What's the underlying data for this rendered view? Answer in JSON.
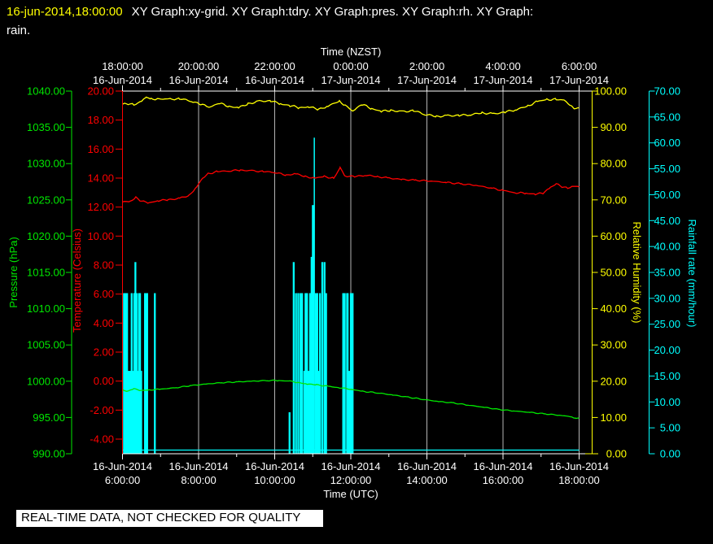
{
  "header": {
    "timestamp": "16-jun-2014,18:00:00",
    "title_rest": "XY Graph:xy-grid.  XY Graph:tdry.  XY Graph:pres.  XY Graph:rh.  XY Graph:",
    "title_line2": "rain."
  },
  "footer": {
    "notice": "REAL-TIME DATA, NOT CHECKED FOR QUALITY"
  },
  "colors": {
    "background": "#000000",
    "pressure": "#00e800",
    "temperature": "#ff0000",
    "humidity": "#ffff00",
    "rain": "#00ffff",
    "grid": "#b5b5b5",
    "axis": "#ffffff"
  },
  "chart_data": {
    "type": "line+bar, multi-axis time series",
    "axes": {
      "top": {
        "title": "Time (NZST)",
        "hours_utc": [
          6,
          8,
          10,
          12,
          14,
          16,
          18
        ],
        "tick_times": [
          "18:00:00",
          "20:00:00",
          "22:00:00",
          "0:00:00",
          "2:00:00",
          "4:00:00",
          "6:00:00"
        ],
        "tick_dates": [
          "16-Jun-2014",
          "16-Jun-2014",
          "16-Jun-2014",
          "17-Jun-2014",
          "17-Jun-2014",
          "17-Jun-2014",
          "17-Jun-2014"
        ]
      },
      "bottom": {
        "title": "Time (UTC)",
        "hours_utc": [
          6,
          8,
          10,
          12,
          14,
          16,
          18
        ],
        "tick_dates": [
          "16-Jun-2014",
          "16-Jun-2014",
          "16-Jun-2014",
          "16-Jun-2014",
          "16-Jun-2014",
          "16-Jun-2014",
          "16-Jun-2014"
        ],
        "tick_times": [
          "6:00:00",
          "8:00:00",
          "10:00:00",
          "12:00:00",
          "14:00:00",
          "16:00:00",
          "18:00:00"
        ]
      },
      "pressure": {
        "title": "Pressure (hPa)",
        "min": 990,
        "max": 1040,
        "labels": [
          "1040.00",
          "1035.00",
          "1030.00",
          "1025.00",
          "1020.00",
          "1015.00",
          "1010.00",
          "1005.00",
          "1000.00",
          "995.00",
          "990.00"
        ]
      },
      "temperature": {
        "title": "Temperature (Celsius)",
        "min": -4,
        "max": 20,
        "labels": [
          "20.00",
          "18.00",
          "16.00",
          "14.00",
          "12.00",
          "10.00",
          "8.00",
          "6.00",
          "4.00",
          "2.00",
          "0.00",
          "-2.00",
          "-4.00"
        ]
      },
      "humidity": {
        "title": "Relative Humidity (%)",
        "min": 0,
        "max": 100,
        "labels": [
          "100.00",
          "90.00",
          "80.00",
          "70.00",
          "60.00",
          "50.00",
          "40.00",
          "30.00",
          "20.00",
          "10.00",
          "0.00"
        ]
      },
      "rain": {
        "title": "Rainfall rate (mm/hour)",
        "min": 0,
        "max": 70,
        "labels": [
          "70.00",
          "65.00",
          "60.00",
          "55.00",
          "50.00",
          "45.00",
          "40.00",
          "35.00",
          "30.00",
          "25.00",
          "20.00",
          "15.00",
          "10.00",
          "5.00",
          "0.00"
        ]
      }
    },
    "x_gridlines_hours_utc": [
      8,
      10,
      12,
      14,
      16,
      18
    ],
    "x_range_hours_utc": [
      6,
      18.34
    ],
    "series": {
      "humidity_pct": [
        [
          6.0,
          96.3
        ],
        [
          6.15,
          96.5
        ],
        [
          6.3,
          96.2
        ],
        [
          6.5,
          97.1
        ],
        [
          6.62,
          98.3
        ],
        [
          6.75,
          97.8
        ],
        [
          6.95,
          97.9
        ],
        [
          7.2,
          97.7
        ],
        [
          7.5,
          97.9
        ],
        [
          7.8,
          97.3
        ],
        [
          8.05,
          96.3
        ],
        [
          8.3,
          95.7
        ],
        [
          8.55,
          96.6
        ],
        [
          8.8,
          95.8
        ],
        [
          9.05,
          95.4
        ],
        [
          9.3,
          96.5
        ],
        [
          9.6,
          97.2
        ],
        [
          9.9,
          97.3
        ],
        [
          10.15,
          96.5
        ],
        [
          10.4,
          96.0
        ],
        [
          10.65,
          95.4
        ],
        [
          10.9,
          95.7
        ],
        [
          11.15,
          94.9
        ],
        [
          11.4,
          95.9
        ],
        [
          11.7,
          97.2
        ],
        [
          11.85,
          96.1
        ],
        [
          12.05,
          94.6
        ],
        [
          12.3,
          96.3
        ],
        [
          12.55,
          95.2
        ],
        [
          12.8,
          94.4
        ],
        [
          13.05,
          94.7
        ],
        [
          13.35,
          94.3
        ],
        [
          13.65,
          94.6
        ],
        [
          13.95,
          93.6
        ],
        [
          14.25,
          93.0
        ],
        [
          14.55,
          93.2
        ],
        [
          14.85,
          93.3
        ],
        [
          15.15,
          93.5
        ],
        [
          15.45,
          94.0
        ],
        [
          15.75,
          93.7
        ],
        [
          16.05,
          94.2
        ],
        [
          16.35,
          94.9
        ],
        [
          16.65,
          95.9
        ],
        [
          16.9,
          97.1
        ],
        [
          17.15,
          97.7
        ],
        [
          17.4,
          97.7
        ],
        [
          17.6,
          97.4
        ],
        [
          17.75,
          96.3
        ],
        [
          17.87,
          94.9
        ],
        [
          17.95,
          95.4
        ],
        [
          18.0,
          95.4
        ]
      ],
      "temperature_c": [
        [
          6.0,
          12.35
        ],
        [
          6.2,
          12.4
        ],
        [
          6.35,
          12.65
        ],
        [
          6.5,
          12.4
        ],
        [
          6.7,
          12.3
        ],
        [
          6.95,
          12.45
        ],
        [
          7.2,
          12.5
        ],
        [
          7.5,
          12.6
        ],
        [
          7.75,
          12.8
        ],
        [
          7.95,
          13.4
        ],
        [
          8.1,
          14.0
        ],
        [
          8.25,
          14.3
        ],
        [
          8.5,
          14.45
        ],
        [
          8.8,
          14.5
        ],
        [
          9.1,
          14.55
        ],
        [
          9.4,
          14.5
        ],
        [
          9.7,
          14.45
        ],
        [
          10.0,
          14.4
        ],
        [
          10.3,
          14.2
        ],
        [
          10.55,
          14.3
        ],
        [
          10.8,
          14.1
        ],
        [
          11.05,
          14.0
        ],
        [
          11.3,
          14.1
        ],
        [
          11.55,
          14.0
        ],
        [
          11.72,
          14.7
        ],
        [
          11.85,
          14.15
        ],
        [
          12.1,
          14.1
        ],
        [
          12.4,
          14.2
        ],
        [
          12.7,
          14.1
        ],
        [
          13.0,
          14.0
        ],
        [
          13.35,
          13.9
        ],
        [
          13.7,
          13.85
        ],
        [
          14.1,
          13.8
        ],
        [
          14.5,
          13.7
        ],
        [
          14.9,
          13.6
        ],
        [
          15.3,
          13.5
        ],
        [
          15.7,
          13.3
        ],
        [
          16.0,
          13.15
        ],
        [
          16.3,
          13.0
        ],
        [
          16.6,
          12.95
        ],
        [
          16.85,
          12.9
        ],
        [
          17.05,
          12.95
        ],
        [
          17.25,
          13.35
        ],
        [
          17.4,
          13.6
        ],
        [
          17.55,
          13.4
        ],
        [
          17.7,
          13.3
        ],
        [
          17.85,
          13.45
        ],
        [
          18.0,
          13.4
        ]
      ],
      "pressure_hpa": [
        [
          6.0,
          998.8
        ],
        [
          6.15,
          998.6
        ],
        [
          6.3,
          999.0
        ],
        [
          6.45,
          998.7
        ],
        [
          6.7,
          998.8
        ],
        [
          7.0,
          998.9
        ],
        [
          7.4,
          999.1
        ],
        [
          7.8,
          999.4
        ],
        [
          8.2,
          999.6
        ],
        [
          8.6,
          999.8
        ],
        [
          9.0,
          999.9
        ],
        [
          9.4,
          1000.0
        ],
        [
          9.8,
          1000.1
        ],
        [
          10.1,
          1000.1
        ],
        [
          10.4,
          1000.0
        ],
        [
          10.65,
          999.8
        ],
        [
          10.85,
          999.6
        ],
        [
          11.1,
          999.5
        ],
        [
          11.4,
          999.3
        ],
        [
          11.7,
          999.1
        ],
        [
          12.0,
          998.9
        ],
        [
          12.3,
          998.6
        ],
        [
          12.7,
          998.4
        ],
        [
          13.1,
          998.1
        ],
        [
          13.5,
          997.8
        ],
        [
          13.9,
          997.5
        ],
        [
          14.3,
          997.2
        ],
        [
          14.7,
          997.0
        ],
        [
          15.1,
          996.7
        ],
        [
          15.5,
          996.4
        ],
        [
          15.9,
          996.1
        ],
        [
          16.3,
          995.9
        ],
        [
          16.7,
          995.7
        ],
        [
          17.1,
          995.5
        ],
        [
          17.5,
          995.3
        ],
        [
          17.8,
          995.1
        ],
        [
          17.92,
          994.9
        ],
        [
          18.0,
          994.9
        ]
      ],
      "rain_bars_mm_hr": [
        [
          6.04,
          31
        ],
        [
          6.08,
          31
        ],
        [
          6.12,
          31
        ],
        [
          6.16,
          16
        ],
        [
          6.2,
          16
        ],
        [
          6.24,
          31
        ],
        [
          6.28,
          16
        ],
        [
          6.31,
          31
        ],
        [
          6.34,
          37
        ],
        [
          6.37,
          31
        ],
        [
          6.4,
          16
        ],
        [
          6.43,
          31
        ],
        [
          6.46,
          31
        ],
        [
          6.49,
          16
        ],
        [
          6.62,
          31,
          5
        ],
        [
          6.85,
          31
        ],
        [
          10.39,
          8
        ],
        [
          10.5,
          37
        ],
        [
          10.56,
          31
        ],
        [
          10.62,
          31
        ],
        [
          10.68,
          31
        ],
        [
          10.72,
          31
        ],
        [
          10.78,
          16
        ],
        [
          10.81,
          31
        ],
        [
          10.85,
          31
        ],
        [
          10.89,
          16
        ],
        [
          10.93,
          31
        ],
        [
          10.97,
          38
        ],
        [
          11.01,
          48,
          3
        ],
        [
          11.04,
          61,
          1.5
        ],
        [
          11.08,
          31
        ],
        [
          11.12,
          31
        ],
        [
          11.16,
          16
        ],
        [
          11.19,
          31
        ],
        [
          11.25,
          37
        ],
        [
          11.31,
          37
        ],
        [
          11.35,
          31
        ],
        [
          11.8,
          31
        ],
        [
          11.84,
          31
        ],
        [
          11.91,
          31,
          3
        ],
        [
          11.96,
          16
        ],
        [
          12.0,
          31
        ],
        [
          12.04,
          31,
          3
        ]
      ]
    }
  }
}
